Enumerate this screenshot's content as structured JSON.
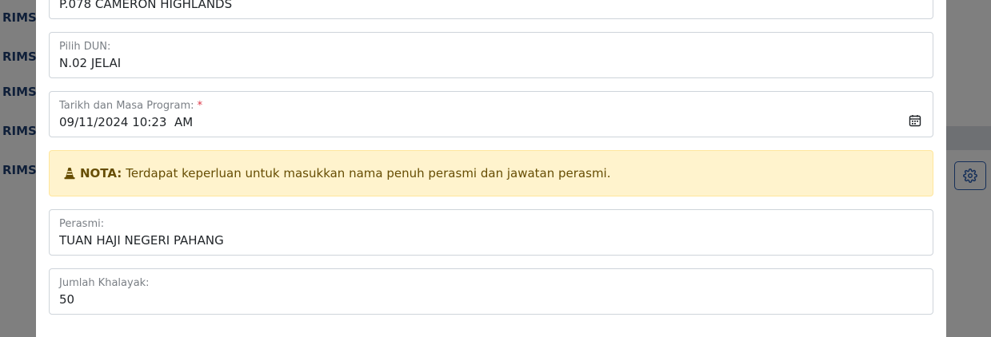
{
  "background": {
    "links": [
      "RIMS@",
      "RIMS@",
      "RIMS@",
      "RIMS@",
      "RIMS@"
    ]
  },
  "form": {
    "parlimen": {
      "value": "P.078 CAMERON HIGHLANDS"
    },
    "dun": {
      "label": "Pilih DUN:",
      "value": "N.02 JELAI"
    },
    "tarikh": {
      "label": "Tarikh dan Masa Program:",
      "required_mark": "*",
      "value": "09/11/2024 10:23  AM"
    },
    "alert": {
      "title": "NOTA:",
      "message": "Terdapat keperluan untuk masukkan nama penuh perasmi dan jawatan perasmi."
    },
    "perasmi": {
      "label": "Perasmi:",
      "value": "TUAN HAJI NEGERI PAHANG"
    },
    "khalayak": {
      "label": "Jumlah Khalayak:",
      "value": "50"
    }
  },
  "colors": {
    "overlay": "#000000",
    "alert_bg": "#fff3cd",
    "alert_text": "#664d03",
    "required": "#dc3545",
    "link": "#1f3f73"
  },
  "icons": [
    "calendar-icon",
    "traffic-cone-icon",
    "gear-icon"
  ]
}
